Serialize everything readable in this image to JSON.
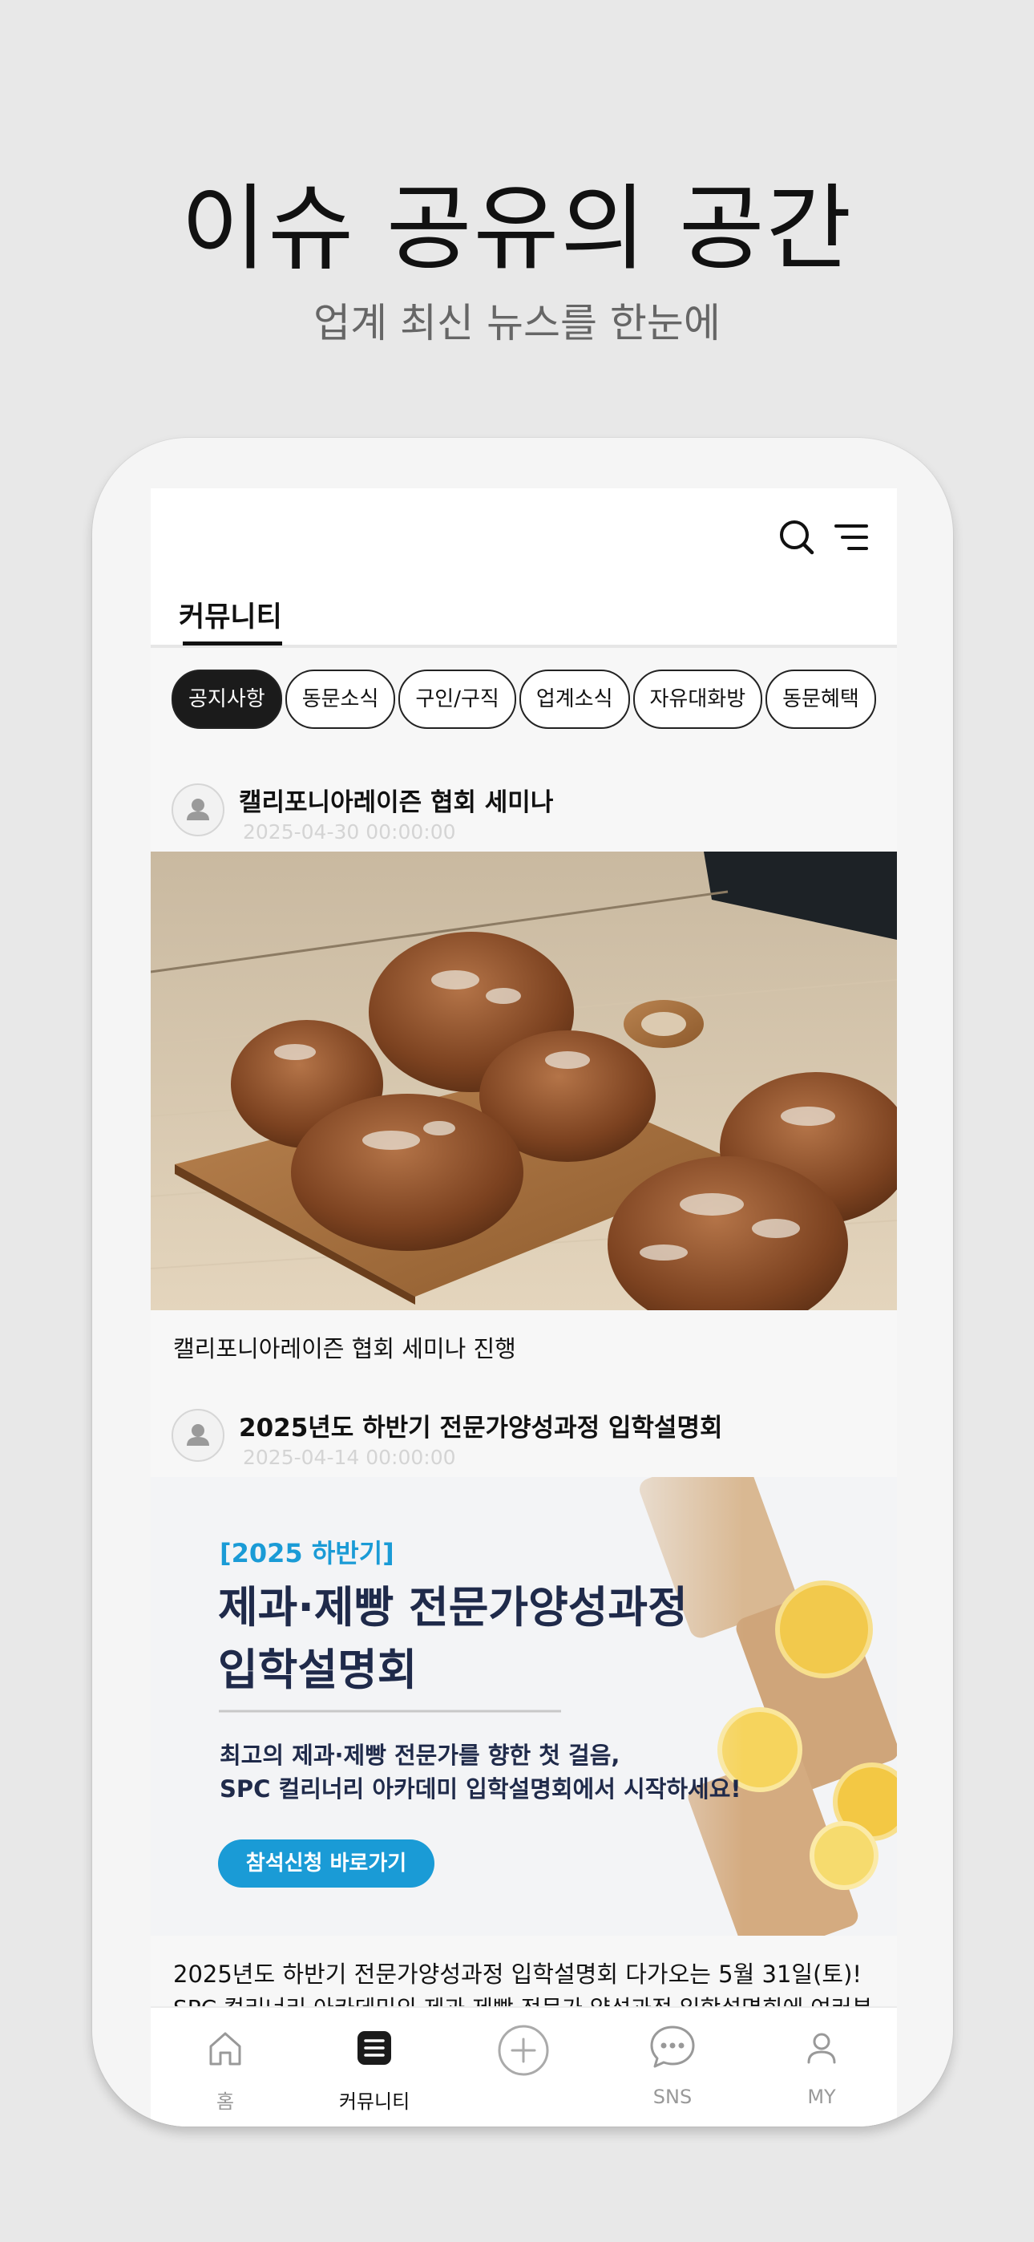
{
  "promo": {
    "title": "이슈 공유의 공간",
    "subtitle": "업계 최신 뉴스를 한눈에"
  },
  "header": {
    "icons": [
      "search-icon",
      "menu-icon"
    ],
    "tab": "커뮤니티"
  },
  "categories": [
    "공지사항",
    "동문소식",
    "구인/구직",
    "업계소식",
    "자유대화방",
    "동문혜택"
  ],
  "selected_category": "공지사항",
  "posts": [
    {
      "title": "캘리포니아레이즌 협회 세미나",
      "date": "2025-04-30 00:00:00",
      "caption": "캘리포니아레이즌 협회 세미나 진행"
    },
    {
      "title": "2025년도 하반기 전문가양성과정 입학설명회",
      "date": "2025-04-14 00:00:00",
      "banner": {
        "tag": "[2025 하반기]",
        "headline_1": "제과·제빵 전문가양성과정",
        "headline_2": "입학설명회",
        "body_1": "최고의 제과·제빵 전문가를 향한 첫 걸음,",
        "body_2": "SPC 컬리너리 아카데미 입학설명회에서 시작하세요!",
        "button": "참석신청 바로가기"
      },
      "caption": "2025년도 하반기 전문가양성과정 입학설명회 다가오는 5월 31일(토)!",
      "caption_2": "SPC 컬리너리 아카데미의 제과·제빵 전문가 양성과정 입학설명회에 여러분"
    }
  ],
  "bottom_nav": [
    {
      "label": "홈",
      "icon": "home-icon"
    },
    {
      "label": "커뮤니티",
      "icon": "community-icon",
      "active": true
    },
    {
      "label": "",
      "icon": "add-icon"
    },
    {
      "label": "SNS",
      "icon": "chat-icon"
    },
    {
      "label": "MY",
      "icon": "person-icon"
    }
  ],
  "colors": {
    "background": "#e8e8e8",
    "chip_active": "#1b1b1b",
    "banner_tag": "#1a9bd6",
    "banner_headline": "#1f2a4a",
    "banner_button": "#1a9bd6"
  }
}
